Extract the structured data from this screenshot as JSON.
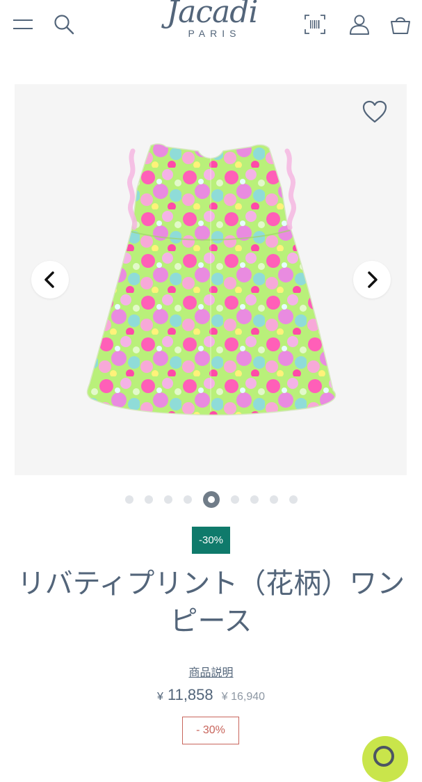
{
  "header": {
    "brand_script": "Jacadi",
    "brand_sub": "PARIS",
    "icons": [
      "menu-icon",
      "search-icon",
      "barcode-scan-icon",
      "account-icon",
      "basket-icon"
    ]
  },
  "gallery": {
    "image_alt": "",
    "slide_count": 9,
    "active_slide": 5
  },
  "product": {
    "discount_badge": "-30%",
    "title": "リバティプリント（花柄）ワンピース",
    "description_link": "商品説明",
    "price_currency": "¥",
    "price_now": "11,858",
    "price_old": "¥ 16,940",
    "discount_label": "- 30%"
  },
  "colors": {
    "text": "#53657a",
    "badge_bg": "#0f7a6b",
    "discount_border": "#c8655c",
    "chat_bg": "#c9e54b",
    "gallery_bg": "#f5f5f5"
  }
}
